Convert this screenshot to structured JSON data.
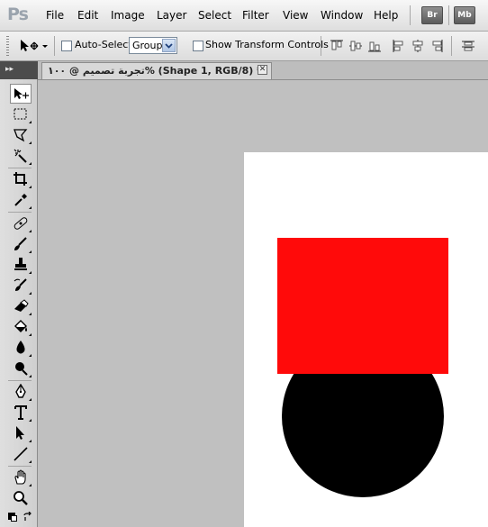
{
  "app": {
    "logo": "Ps"
  },
  "menu": [
    "File",
    "Edit",
    "Image",
    "Layer",
    "Select",
    "Filter",
    "View",
    "Window",
    "Help"
  ],
  "bridge_buttons": [
    "Br",
    "Mb"
  ],
  "options_bar": {
    "auto_select_label": "Auto-Select:",
    "auto_select_checked": false,
    "auto_select_value": "Group",
    "show_transform_label": "Show Transform Controls",
    "show_transform_checked": false
  },
  "document_tab": {
    "title": "تجربة تصميم @ ١٠٠% (Shape 1, RGB/8) *",
    "close_label": "✕"
  },
  "panel_collapse_label": "▸▸",
  "toolbar": {
    "tools": [
      "move",
      "rectangular-marquee",
      "polygonal-lasso",
      "magic-wand",
      "crop",
      "eyedropper",
      "spot-healing-brush",
      "brush",
      "clone-stamp",
      "history-brush",
      "eraser",
      "paint-bucket",
      "blur",
      "dodge",
      "pen",
      "type",
      "path-selection",
      "line",
      "hand",
      "zoom"
    ],
    "active_tool": "move"
  },
  "canvas": {
    "background_color": "#ffffff",
    "shapes": [
      {
        "name": "red-rectangle",
        "color": "#ff0a0a"
      },
      {
        "name": "black-circle",
        "color": "#000000"
      }
    ]
  },
  "colors": {
    "foreground": "#000000",
    "background": "#ffffff"
  }
}
